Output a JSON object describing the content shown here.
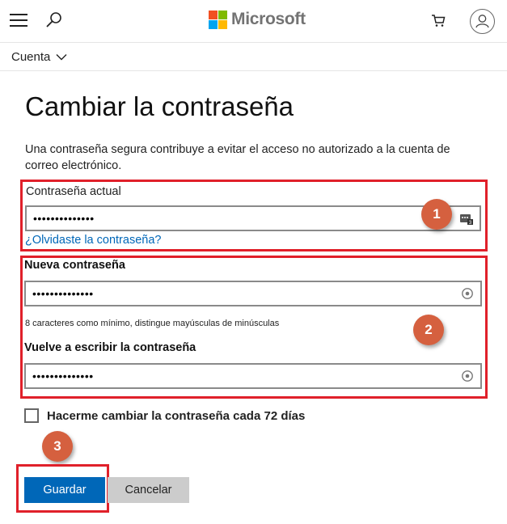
{
  "header": {
    "logo_text": "Microsoft",
    "logo_colors": [
      "#f25022",
      "#7fba00",
      "#00a4ef",
      "#ffb900"
    ]
  },
  "subnav": {
    "account_label": "Cuenta"
  },
  "page": {
    "title": "Cambiar la contraseña",
    "description": "Una contraseña segura contribuye a evitar el acceso no autorizado a la cuenta de correo electrónico."
  },
  "current_password": {
    "label": "Contraseña actual",
    "value": "••••••••••••••",
    "forgot_link": "¿Olvidaste la contraseña?"
  },
  "new_password": {
    "label": "Nueva contraseña",
    "value": "••••••••••••••",
    "hint": "8 caracteres como mínimo, distingue mayúsculas de minúsculas"
  },
  "confirm_password": {
    "label": "Vuelve a escribir la contraseña",
    "value": "••••••••••••••"
  },
  "force_change": {
    "label": "Hacerme cambiar la contraseña cada 72 días",
    "checked": false
  },
  "buttons": {
    "save": "Guardar",
    "cancel": "Cancelar"
  },
  "annotations": {
    "step1": "1",
    "step2": "2",
    "step3": "3",
    "highlight_color": "#e0202a",
    "badge_color": "#d5603f"
  },
  "icons": {
    "menu": "hamburger-menu-icon",
    "search": "search-icon",
    "cart": "shopping-cart-icon",
    "account": "user-account-icon",
    "dropdown": "chevron-down-icon",
    "password_manager": "password-manager-icon",
    "reveal": "password-reveal-icon"
  }
}
